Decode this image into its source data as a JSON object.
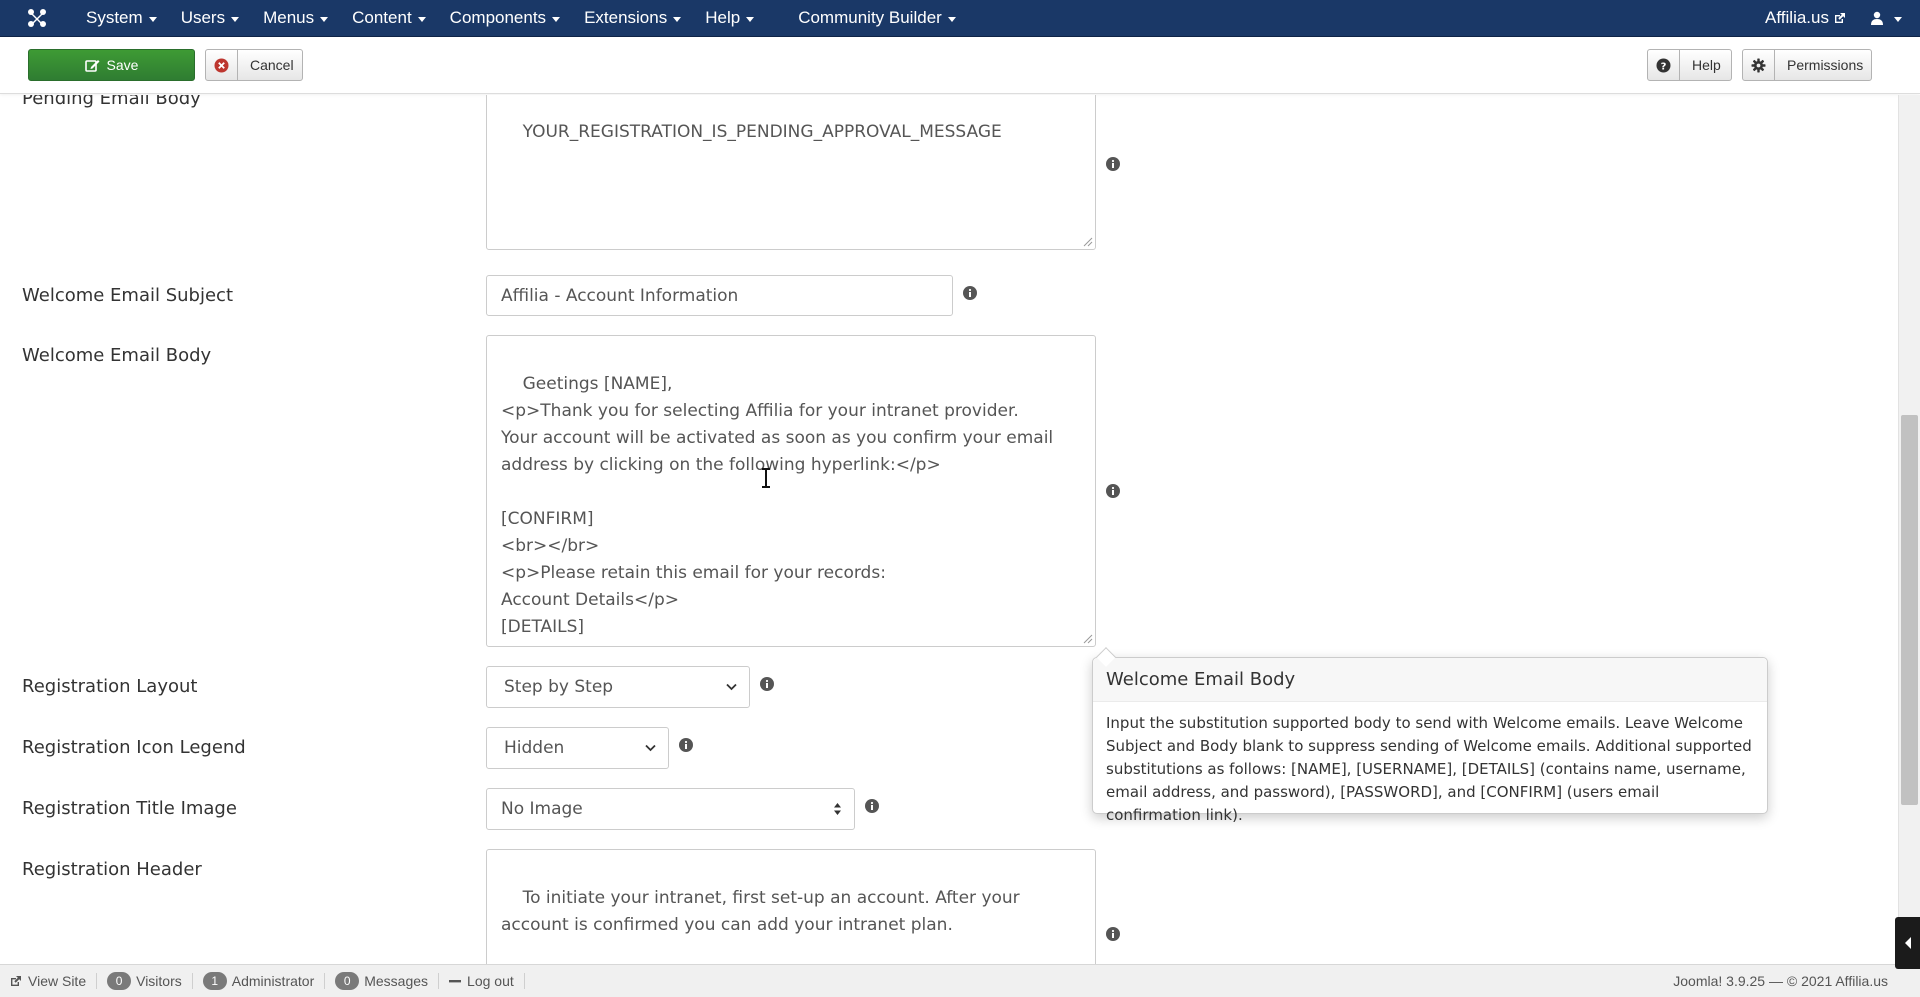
{
  "navbar": {
    "menu": [
      "System",
      "Users",
      "Menus",
      "Content",
      "Components",
      "Extensions",
      "Help",
      "Community Builder"
    ],
    "site_name": "Affilia.us"
  },
  "toolbar": {
    "save_label": "Save",
    "cancel_label": "Cancel",
    "help_label": "Help",
    "permissions_label": "Permissions"
  },
  "fields": {
    "pending_email_body": {
      "label": "Pending Email Body",
      "value": "YOUR_REGISTRATION_IS_PENDING_APPROVAL_MESSAGE"
    },
    "welcome_email_subject": {
      "label": "Welcome Email Subject",
      "value": "Affilia - Account Information"
    },
    "welcome_email_body": {
      "label": "Welcome Email Body",
      "value": "Geetings [NAME],\n<p>Thank you for selecting Affilia for your intranet provider.\nYour account will be activated as soon as you confirm your email address by clicking on the following hyperlink:</p>\n\n[CONFIRM]\n<br></br>\n<p>Please retain this email for your records:\nAccount Details</p>\n[DETAILS]"
    },
    "registration_layout": {
      "label": "Registration Layout",
      "value": "Step by Step"
    },
    "registration_icon_legend": {
      "label": "Registration Icon Legend",
      "value": "Hidden"
    },
    "registration_title_image": {
      "label": "Registration Title Image",
      "value": "No Image"
    },
    "registration_header": {
      "label": "Registration Header",
      "value": "To initiate your intranet, first set-up an account. After your account is confirmed you can add your intranet plan."
    }
  },
  "popover": {
    "title": "Welcome Email Body",
    "body": "Input the substitution supported body to send with Welcome emails. Leave Welcome Subject and Body blank to suppress sending of Welcome emails. Additional supported substitutions as follows: [NAME], [USERNAME], [DETAILS] (contains name, username, email address, and password), [PASSWORD], and [CONFIRM] (users email confirmation link)."
  },
  "statusbar": {
    "view_site": "View Site",
    "visitors_count": "0",
    "visitors_label": "Visitors",
    "admin_count": "1",
    "admin_label": "Administrator",
    "messages_count": "0",
    "messages_label": "Messages",
    "logout_label": "Log out",
    "version": "Joomla! 3.9.25",
    "copyright": "© 2021 Affilia.us"
  },
  "colors": {
    "navbar_bg": "#1a3867",
    "save_green": "#3e9b34",
    "cancel_red": "#bd362f"
  }
}
